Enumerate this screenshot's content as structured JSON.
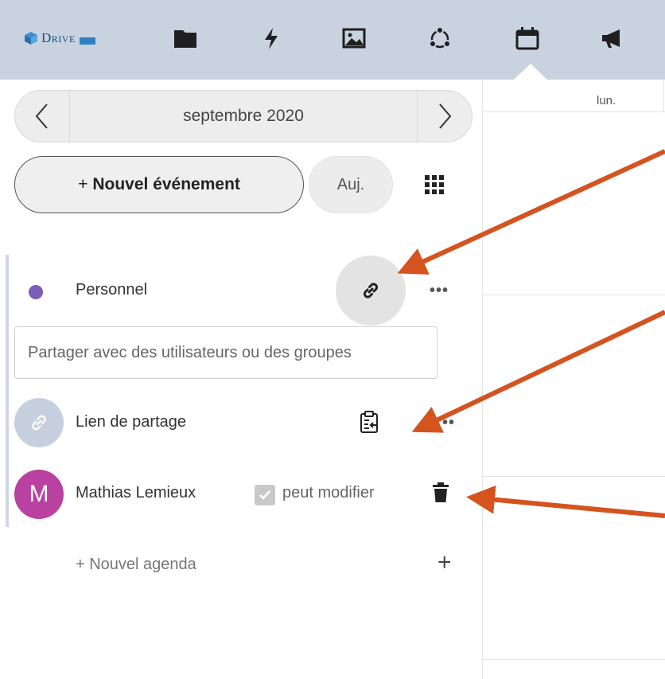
{
  "header": {
    "logo_text": "Drive",
    "nav_icons": [
      "folder-icon",
      "bolt-icon",
      "image-icon",
      "circles-icon",
      "calendar-icon",
      "megaphone-icon"
    ],
    "active_icon": "calendar-icon",
    "bar_color": "#c9d3e0"
  },
  "sidebar": {
    "month_label": "septembre 2020",
    "new_event_plus": "+",
    "new_event_label": "Nouvel événement",
    "today_label": "Auj.",
    "calendar": {
      "name": "Personnel",
      "color": "#7d5eb6",
      "more_label": "•••"
    },
    "share": {
      "placeholder": "Partager avec des utilisateurs ou des groupes",
      "link_label": "Lien de partage",
      "link_more": "••",
      "user_initial": "M",
      "user_name": "Mathias Lemieux",
      "user_color": "#b9419f",
      "can_edit_label": "peut modifier",
      "can_edit_checked": true
    },
    "new_calendar_label": "+ Nouvel agenda",
    "new_calendar_plus": "+"
  },
  "calendar_view": {
    "day_header": "lun."
  },
  "annotations": {
    "arrow_color": "#d4531f"
  }
}
